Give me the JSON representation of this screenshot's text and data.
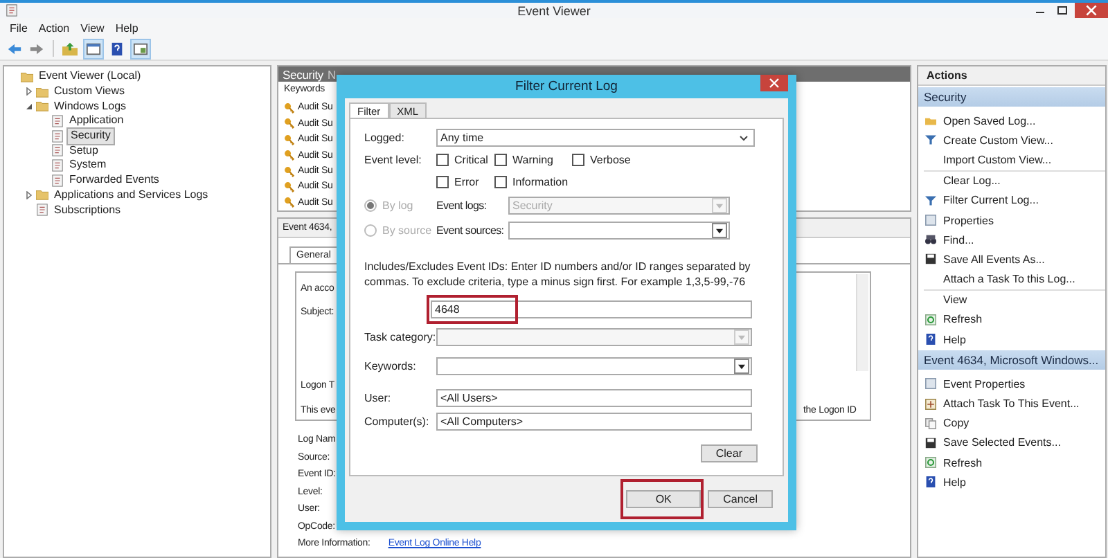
{
  "window": {
    "title": "Event Viewer"
  },
  "menu": [
    "File",
    "Action",
    "View",
    "Help"
  ],
  "tree": [
    {
      "label": "Event Viewer (Local)",
      "selected": false,
      "children": [
        {
          "label": "Custom Views",
          "selected": false,
          "expanded": false
        },
        {
          "label": "Windows Logs",
          "selected": false,
          "expanded": true,
          "children": [
            {
              "label": "Application",
              "selected": false
            },
            {
              "label": "Security",
              "selected": true
            },
            {
              "label": "Setup",
              "selected": false
            },
            {
              "label": "System",
              "selected": false
            },
            {
              "label": "Forwarded Events",
              "selected": false
            }
          ]
        },
        {
          "label": "Applications and Services Logs",
          "selected": false,
          "expanded": false
        },
        {
          "label": "Subscriptions",
          "selected": false
        }
      ]
    }
  ],
  "log_pane": {
    "title": "Security",
    "title_rest": "N",
    "column": "Keywords",
    "rows": [
      "Audit Su",
      "Audit Su",
      "Audit Su",
      "Audit Su",
      "Audit Su",
      "Audit Su",
      "Audit Su"
    ]
  },
  "event_pane": {
    "title": "Event 4634,",
    "tabs": [
      {
        "label": "General",
        "selected": true
      }
    ],
    "description": [
      "An acco",
      "Subject:",
      "Logon T",
      "This eve"
    ],
    "side_text": "the Logon ID",
    "fields": [
      "Log Nam",
      "Source:",
      "Event ID:",
      "Level:",
      "User:",
      "OpCode:"
    ],
    "more_info": {
      "label": "More Information:",
      "link": "Event Log Online Help"
    }
  },
  "actions": {
    "title": "Actions",
    "sections": [
      {
        "title": "Security",
        "groups": [
          [
            {
              "label": "Open Saved Log...",
              "kind": "open"
            },
            {
              "label": "Create Custom View...",
              "kind": "filter"
            },
            {
              "label": "Import Custom View...",
              "kind": "none"
            }
          ],
          [
            {
              "label": "Clear Log...",
              "kind": "none"
            },
            {
              "label": "Filter Current Log...",
              "kind": "filter"
            },
            {
              "label": "Properties",
              "kind": "properties"
            },
            {
              "label": "Find...",
              "kind": "find"
            },
            {
              "label": "Save All Events As...",
              "kind": "save"
            },
            {
              "label": "Attach a Task To this Log...",
              "kind": "none"
            }
          ],
          [
            {
              "label": "View",
              "kind": "none"
            },
            {
              "label": "Refresh",
              "kind": "refresh"
            },
            {
              "label": "Help",
              "kind": "help"
            }
          ]
        ]
      },
      {
        "title": "Event 4634, Microsoft Windows...",
        "groups": [
          [
            {
              "label": "Event Properties",
              "kind": "properties"
            },
            {
              "label": "Attach Task To This Event...",
              "kind": "attach"
            },
            {
              "label": "Copy",
              "kind": "copy"
            },
            {
              "label": "Save Selected Events...",
              "kind": "save"
            },
            {
              "label": "Refresh",
              "kind": "refresh"
            },
            {
              "label": "Help",
              "kind": "help"
            }
          ]
        ]
      }
    ]
  },
  "dialog": {
    "title": "Filter Current Log",
    "tabs": [
      {
        "label": "Filter",
        "selected": true
      },
      {
        "label": "XML",
        "selected": false
      }
    ],
    "logged": {
      "label": "Logged:",
      "value": "Any time"
    },
    "event_level": {
      "label": "Event level:",
      "options": [
        {
          "label": "Critical",
          "checked": false
        },
        {
          "label": "Warning",
          "checked": false
        },
        {
          "label": "Verbose",
          "checked": false
        },
        {
          "label": "Error",
          "checked": false
        },
        {
          "label": "Information",
          "checked": false
        }
      ]
    },
    "sources": [
      {
        "label": "By log",
        "selected": true,
        "disabled": true,
        "field_label": "Event logs:",
        "value": "Security",
        "field_disabled": true
      },
      {
        "label": "By source",
        "selected": false,
        "disabled": true,
        "field_label": "Event sources:",
        "field_disabled": false
      }
    ],
    "ids_hint": "Includes/Excludes Event IDs: Enter ID numbers and/or ID ranges separated by commas. To exclude criteria, type a minus sign first. For example 1,3,5-99,-76",
    "event_ids": {
      "value": "4648",
      "highlighted": true
    },
    "task_category": {
      "label": "Task category:",
      "disabled": true
    },
    "keywords": {
      "label": "Keywords:",
      "disabled": false
    },
    "user": {
      "label": "User:",
      "value": "<All Users>"
    },
    "computer": {
      "label": "Computer(s):",
      "value": "<All Computers>"
    },
    "clear_button": "Clear",
    "ok_button": {
      "label": "OK",
      "highlighted": true
    },
    "cancel_button": "Cancel"
  }
}
